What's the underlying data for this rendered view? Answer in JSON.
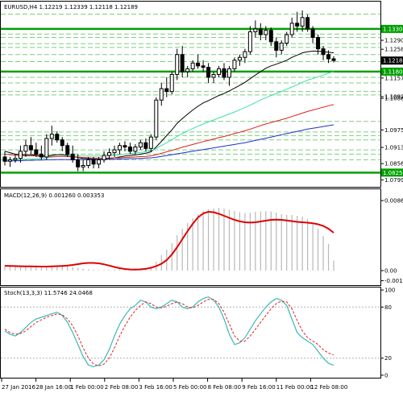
{
  "main": {
    "header": "EURUSD,H4  1.12219 1.12339 1.12118 1.12189",
    "ylim": [
      1.0775,
      1.1426
    ],
    "price_ticks": [
      "1.13300",
      "1.12900",
      "1.12585",
      "1.12188",
      "1.11800",
      "1.11575",
      "1.10920",
      "1.10860",
      "1.10920",
      "1.09750",
      "1.09135",
      "1.08565",
      "1.08250",
      "1.07995"
    ],
    "price_tick_values": [
      1.133,
      1.129,
      1.12585,
      1.12188,
      1.118,
      1.11575,
      1.1092,
      1.1086,
      1.1092,
      1.0975,
      1.09135,
      1.08565,
      1.0825,
      1.07995
    ],
    "current_price": "1.12188",
    "highlight_labels": [
      {
        "text": "1.13300",
        "value": 1.133
      },
      {
        "text": "1.11800",
        "value": 1.118
      },
      {
        "text": "1.08250",
        "value": 1.0825
      }
    ],
    "levels_solid_green": [
      1.133,
      1.118,
      1.0825
    ],
    "levels_dashed_green": [
      1.1382,
      1.1312,
      1.13,
      1.1278,
      1.1265,
      1.124,
      1.1215,
      1.116,
      1.114,
      1.111,
      1.1098,
      1.1005,
      1.0968,
      1.0955,
      1.094,
      1.0905,
      1.089,
      1.087
    ]
  },
  "macd": {
    "label": "MACD(12,26,9) 0.001260 0.003353",
    "ticks": [
      "0.008697",
      "0.00",
      "-0.001260"
    ],
    "tick_values": [
      0.008697,
      0.0,
      -0.00126
    ],
    "ylim": [
      -0.0016,
      0.0089
    ]
  },
  "stoch": {
    "label": "Stoch(13,3,3) 11.5746 24.0468",
    "ticks": [
      "100",
      "80",
      "20",
      "0"
    ],
    "tick_values": [
      100,
      80,
      20,
      0
    ],
    "ylim": [
      -2,
      102
    ]
  },
  "time_axis": {
    "labels": [
      "27 Jan 2016",
      "28 Jan 16:00",
      "1 Feb 00:00",
      "2 Feb 08:00",
      "3 Feb 16:00",
      "5 Feb 00:00",
      "8 Feb 08:00",
      "9 Feb 16:00",
      "11 Feb 00:00",
      "12 Feb 08:00"
    ]
  },
  "colors": {
    "candle": "#000000",
    "support_line": "#00a000",
    "dashed_level": "#7ccf7c",
    "ma_black": "#000000",
    "ma_aqua": "#3ce0a8",
    "ma_red": "#e02020",
    "ma_blue": "#2030d0",
    "macd_hist": "#b8b8b8",
    "macd_signal": "#e00000",
    "stoch_main": "#3cb8b8",
    "stoch_signal": "#e02020",
    "price_tag_bg": "#000000"
  },
  "chart_data": {
    "type": "candlestick",
    "symbol": "EURUSD",
    "timeframe": "H4",
    "candles": [
      [
        1.088,
        1.09,
        1.085,
        1.0865
      ],
      [
        1.0865,
        1.088,
        1.0845,
        1.087
      ],
      [
        1.087,
        1.089,
        1.086,
        1.0875
      ],
      [
        1.0875,
        1.092,
        1.086,
        1.09
      ],
      [
        1.09,
        1.094,
        1.088,
        1.092
      ],
      [
        1.092,
        1.095,
        1.089,
        1.0905
      ],
      [
        1.0905,
        1.093,
        1.088,
        1.089
      ],
      [
        1.089,
        1.092,
        1.087,
        1.088
      ],
      [
        1.088,
        1.096,
        1.087,
        1.0945
      ],
      [
        1.0945,
        1.099,
        1.092,
        1.096
      ],
      [
        1.096,
        1.097,
        1.093,
        1.094
      ],
      [
        1.094,
        1.095,
        1.09,
        1.092
      ],
      [
        1.092,
        1.093,
        1.088,
        1.089
      ],
      [
        1.089,
        1.092,
        1.086,
        1.087
      ],
      [
        1.087,
        1.089,
        1.083,
        1.0845
      ],
      [
        1.0845,
        1.087,
        1.083,
        1.085
      ],
      [
        1.085,
        1.088,
        1.084,
        1.087
      ],
      [
        1.087,
        1.088,
        1.084,
        1.0855
      ],
      [
        1.0855,
        1.088,
        1.084,
        1.087
      ],
      [
        1.087,
        1.09,
        1.086,
        1.0885
      ],
      [
        1.0885,
        1.091,
        1.087,
        1.0895
      ],
      [
        1.0895,
        1.092,
        1.088,
        1.0905
      ],
      [
        1.0905,
        1.093,
        1.089,
        1.092
      ],
      [
        1.092,
        1.0935,
        1.09,
        1.0915
      ],
      [
        1.0915,
        1.093,
        1.089,
        1.09
      ],
      [
        1.09,
        1.0925,
        1.089,
        1.0915
      ],
      [
        1.0915,
        1.094,
        1.0905,
        1.093
      ],
      [
        1.093,
        1.0945,
        1.09,
        1.091
      ],
      [
        1.091,
        1.096,
        1.09,
        1.095
      ],
      [
        1.095,
        1.109,
        1.094,
        1.108
      ],
      [
        1.108,
        1.114,
        1.106,
        1.112
      ],
      [
        1.112,
        1.116,
        1.109,
        1.111
      ],
      [
        1.111,
        1.118,
        1.11,
        1.117
      ],
      [
        1.117,
        1.126,
        1.115,
        1.124
      ],
      [
        1.124,
        1.127,
        1.116,
        1.118
      ],
      [
        1.118,
        1.12,
        1.116,
        1.119
      ],
      [
        1.119,
        1.122,
        1.118,
        1.121
      ],
      [
        1.121,
        1.124,
        1.119,
        1.12
      ],
      [
        1.12,
        1.122,
        1.118,
        1.1195
      ],
      [
        1.1195,
        1.121,
        1.114,
        1.116
      ],
      [
        1.116,
        1.118,
        1.114,
        1.117
      ],
      [
        1.117,
        1.12,
        1.116,
        1.119
      ],
      [
        1.119,
        1.121,
        1.115,
        1.116
      ],
      [
        1.116,
        1.12,
        1.113,
        1.119
      ],
      [
        1.119,
        1.123,
        1.118,
        1.122
      ],
      [
        1.122,
        1.124,
        1.12,
        1.123
      ],
      [
        1.123,
        1.126,
        1.121,
        1.125
      ],
      [
        1.125,
        1.134,
        1.124,
        1.132
      ],
      [
        1.132,
        1.136,
        1.13,
        1.133
      ],
      [
        1.133,
        1.135,
        1.129,
        1.131
      ],
      [
        1.131,
        1.134,
        1.129,
        1.1325
      ],
      [
        1.1325,
        1.1335,
        1.127,
        1.1285
      ],
      [
        1.1285,
        1.13,
        1.123,
        1.1255
      ],
      [
        1.1255,
        1.129,
        1.124,
        1.128
      ],
      [
        1.128,
        1.132,
        1.127,
        1.131
      ],
      [
        1.131,
        1.137,
        1.13,
        1.135
      ],
      [
        1.135,
        1.139,
        1.132,
        1.134
      ],
      [
        1.134,
        1.1395,
        1.132,
        1.137
      ],
      [
        1.137,
        1.138,
        1.132,
        1.133
      ],
      [
        1.133,
        1.134,
        1.128,
        1.13
      ],
      [
        1.13,
        1.131,
        1.124,
        1.126
      ],
      [
        1.126,
        1.127,
        1.122,
        1.124
      ],
      [
        1.124,
        1.1255,
        1.121,
        1.1225
      ],
      [
        1.1225,
        1.1234,
        1.1212,
        1.1219
      ]
    ],
    "series": [
      {
        "name": "MA black",
        "values": [
          1.09,
          1.0895,
          1.089,
          1.0888,
          1.0888,
          1.0888,
          1.0886,
          1.0884,
          1.0884,
          1.0886,
          1.0888,
          1.0888,
          1.0886,
          1.0882,
          1.0878,
          1.0875,
          1.0874,
          1.0873,
          1.0872,
          1.0873,
          1.0875,
          1.0877,
          1.088,
          1.0883,
          1.0885,
          1.0887,
          1.089,
          1.0893,
          1.0898,
          1.0915,
          1.0935,
          1.0955,
          1.0975,
          1.0998,
          1.1015,
          1.103,
          1.1045,
          1.1058,
          1.107,
          1.1078,
          1.1087,
          1.1096,
          1.1103,
          1.1112,
          1.1122,
          1.1132,
          1.1142,
          1.1155,
          1.1168,
          1.118,
          1.1192,
          1.12,
          1.1206,
          1.1213,
          1.122,
          1.123,
          1.1238,
          1.1246,
          1.125,
          1.1252,
          1.1252,
          1.125,
          1.1248,
          1.1246
        ]
      },
      {
        "name": "MA aqua",
        "values": [
          1.087,
          1.087,
          1.087,
          1.0871,
          1.0872,
          1.0873,
          1.0874,
          1.0875,
          1.0877,
          1.0879,
          1.0881,
          1.0882,
          1.0883,
          1.0883,
          1.0883,
          1.0883,
          1.0883,
          1.0883,
          1.0883,
          1.0884,
          1.0885,
          1.0886,
          1.0888,
          1.089,
          1.0892,
          1.0894,
          1.0896,
          1.0898,
          1.0902,
          1.091,
          1.092,
          1.093,
          1.094,
          1.0952,
          1.0962,
          1.0972,
          1.098,
          1.0988,
          1.0996,
          1.1003,
          1.101,
          1.1017,
          1.1024,
          1.1031,
          1.1038,
          1.1046,
          1.1054,
          1.1062,
          1.1071,
          1.108,
          1.1088,
          1.1096,
          1.1103,
          1.111,
          1.1118,
          1.1126,
          1.1134,
          1.1142,
          1.115,
          1.1156,
          1.1162,
          1.1168,
          1.1174,
          1.118
        ]
      },
      {
        "name": "MA red",
        "values": [
          1.089,
          1.0888,
          1.0886,
          1.0885,
          1.0884,
          1.0884,
          1.0883,
          1.0882,
          1.0882,
          1.0882,
          1.0882,
          1.0882,
          1.0881,
          1.088,
          1.0879,
          1.0878,
          1.0877,
          1.0876,
          1.0876,
          1.0876,
          1.0876,
          1.0877,
          1.0877,
          1.0878,
          1.0879,
          1.088,
          1.0881,
          1.0882,
          1.0884,
          1.0888,
          1.0893,
          1.0898,
          1.0903,
          1.0909,
          1.0914,
          1.0919,
          1.0924,
          1.0929,
          1.0934,
          1.0938,
          1.0943,
          1.0948,
          1.0952,
          1.0957,
          1.0962,
          1.0967,
          1.0972,
          1.0978,
          1.0984,
          1.099,
          1.0996,
          1.1001,
          1.1006,
          1.1011,
          1.1016,
          1.1022,
          1.1028,
          1.1034,
          1.104,
          1.1045,
          1.105,
          1.1055,
          1.106,
          1.1064
        ]
      },
      {
        "name": "MA blue",
        "values": [
          1.0865,
          1.0866,
          1.0866,
          1.0867,
          1.0868,
          1.0868,
          1.0869,
          1.0869,
          1.087,
          1.087,
          1.0871,
          1.0871,
          1.0871,
          1.0871,
          1.0871,
          1.0871,
          1.0871,
          1.0871,
          1.0871,
          1.0871,
          1.0872,
          1.0872,
          1.0873,
          1.0873,
          1.0874,
          1.0874,
          1.0875,
          1.0876,
          1.0877,
          1.0879,
          1.0882,
          1.0885,
          1.0888,
          1.0891,
          1.0894,
          1.0897,
          1.09,
          1.0903,
          1.0906,
          1.0909,
          1.0912,
          1.0915,
          1.0918,
          1.0921,
          1.0924,
          1.0927,
          1.093,
          1.0934,
          1.0938,
          1.0942,
          1.0946,
          1.095,
          1.0954,
          1.0958,
          1.0962,
          1.0966,
          1.097,
          1.0974,
          1.0978,
          1.0981,
          1.0984,
          1.0987,
          1.099,
          1.0993
        ]
      }
    ],
    "macd_hist": [
      0.0006,
      0.00055,
      0.0005,
      0.00048,
      0.0005,
      0.00052,
      0.0005,
      0.00048,
      0.00052,
      0.00058,
      0.0006,
      0.00058,
      0.00052,
      0.00044,
      0.00034,
      0.00025,
      0.00018,
      0.00012,
      8e-05,
      8e-05,
      0.0001,
      0.00014,
      0.00018,
      0.00022,
      0.00024,
      0.00026,
      0.0003,
      0.00034,
      0.00044,
      0.0011,
      0.0019,
      0.0026,
      0.0034,
      0.0044,
      0.0052,
      0.0059,
      0.0065,
      0.007,
      0.0074,
      0.0076,
      0.0077,
      0.0078,
      0.0077,
      0.00755,
      0.0074,
      0.00725,
      0.00715,
      0.0072,
      0.0073,
      0.00735,
      0.00738,
      0.00735,
      0.0072,
      0.007,
      0.0069,
      0.0069,
      0.0068,
      0.0067,
      0.0064,
      0.0059,
      0.0052,
      0.0043,
      0.0033,
      0.00126
    ],
    "macd_signal": [
      0.0006,
      0.00058,
      0.00056,
      0.00054,
      0.00053,
      0.00052,
      0.00051,
      0.0005,
      0.0005,
      0.00052,
      0.00055,
      0.00058,
      0.00062,
      0.0007,
      0.0008,
      0.0009,
      0.00095,
      0.00095,
      0.0009,
      0.00078,
      0.00062,
      0.00045,
      0.0003,
      0.0002,
      0.00014,
      0.00012,
      0.00015,
      0.00022,
      0.00035,
      0.00055,
      0.00085,
      0.0013,
      0.002,
      0.0029,
      0.0039,
      0.0049,
      0.0058,
      0.0066,
      0.0071,
      0.0073,
      0.00725,
      0.00705,
      0.0068,
      0.00655,
      0.0063,
      0.00612,
      0.006,
      0.00596,
      0.006,
      0.0061,
      0.0062,
      0.0063,
      0.00632,
      0.0063,
      0.00622,
      0.00614,
      0.00605,
      0.006,
      0.00595,
      0.00588,
      0.00575,
      0.00555,
      0.0052,
      0.0047
    ],
    "stoch_main": [
      52,
      48,
      46,
      50,
      56,
      62,
      66,
      68,
      70,
      72,
      74,
      70,
      62,
      50,
      36,
      22,
      12,
      10,
      12,
      18,
      30,
      46,
      60,
      70,
      78,
      82,
      88,
      86,
      80,
      78,
      80,
      84,
      88,
      86,
      80,
      78,
      80,
      86,
      90,
      92,
      88,
      80,
      66,
      48,
      36,
      38,
      44,
      54,
      64,
      72,
      80,
      86,
      90,
      88,
      82,
      66,
      50,
      44,
      40,
      36,
      28,
      20,
      14,
      11.6
    ],
    "stoch_signal": [
      54,
      50,
      48,
      49,
      52,
      57,
      62,
      65,
      68,
      70,
      72,
      71,
      66,
      58,
      46,
      32,
      20,
      13,
      11,
      13,
      20,
      32,
      46,
      58,
      68,
      76,
      82,
      86,
      84,
      80,
      79,
      81,
      84,
      86,
      84,
      80,
      79,
      82,
      86,
      89,
      89,
      84,
      74,
      60,
      46,
      40,
      40,
      46,
      54,
      62,
      70,
      78,
      84,
      87,
      86,
      78,
      64,
      52,
      44,
      40,
      36,
      30,
      26,
      24.0
    ]
  }
}
